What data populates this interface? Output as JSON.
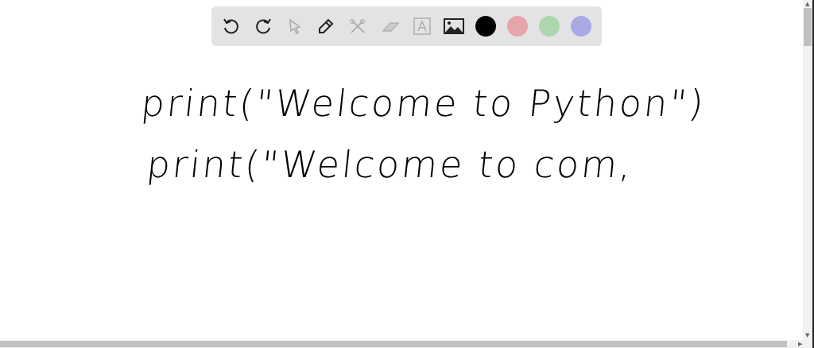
{
  "toolbar": {
    "tools": [
      "undo-icon",
      "redo-icon",
      "select-icon",
      "pen-icon",
      "tools-icon",
      "eraser-icon",
      "text-icon",
      "image-icon"
    ],
    "colors": [
      "#000000",
      "#e8a4ab",
      "#acd6ad",
      "#a9a9e6"
    ]
  },
  "canvas": {
    "line1": "print(\"Welcome to Python\")",
    "line2": "print(\"Welcome to com,"
  }
}
